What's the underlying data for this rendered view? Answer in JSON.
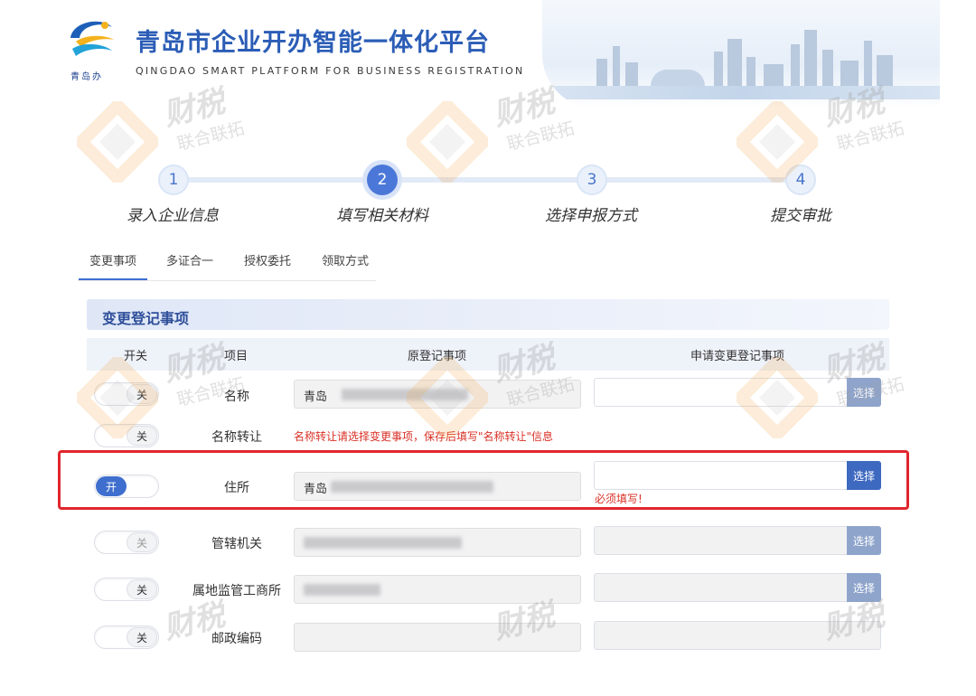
{
  "header": {
    "logo_caption": "青岛办",
    "title": "青岛市企业开办智能一体化平台",
    "subtitle": "QINGDAO SMART PLATFORM FOR BUSINESS REGISTRATION"
  },
  "steps": [
    {
      "number": "1",
      "label": "录入企业信息",
      "state": "done"
    },
    {
      "number": "2",
      "label": "填写相关材料",
      "state": "active"
    },
    {
      "number": "3",
      "label": "选择申报方式",
      "state": "pending"
    },
    {
      "number": "4",
      "label": "提交审批",
      "state": "pending"
    }
  ],
  "tabs": [
    {
      "label": "变更事项",
      "active": true
    },
    {
      "label": "多证合一",
      "active": false
    },
    {
      "label": "授权委托",
      "active": false
    },
    {
      "label": "领取方式",
      "active": false
    }
  ],
  "section": {
    "title": "变更登记事项",
    "headers": {
      "switch": "开关",
      "item": "项目",
      "original": "原登记事项",
      "requested": "申请变更登记事项"
    }
  },
  "rows": [
    {
      "switch": "关",
      "item": "名称",
      "original": "青岛",
      "button": "选择"
    },
    {
      "switch": "关",
      "item": "名称转让",
      "note": "名称转让请选择变更事项，保存后填写\"名称转让\"信息"
    },
    {
      "switch": "开",
      "item": "住所",
      "original": "青岛",
      "button": "选择",
      "error": "必须填写!"
    },
    {
      "switch": "关",
      "item": "管辖机关",
      "original": "",
      "button": "选择"
    },
    {
      "switch": "关",
      "item": "属地监管工商所",
      "original": "",
      "button": "选择"
    },
    {
      "switch": "关",
      "item": "邮政编码",
      "original": ""
    }
  ],
  "watermark": {
    "line1": "财税",
    "line2": "联合联拓"
  },
  "colors": {
    "primary": "#3f6fce",
    "error": "#d93025",
    "title": "#2b5db6"
  }
}
